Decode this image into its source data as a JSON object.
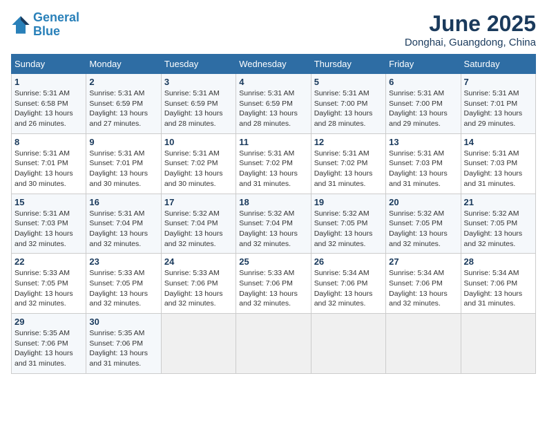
{
  "header": {
    "logo_line1": "General",
    "logo_line2": "Blue",
    "month_year": "June 2025",
    "location": "Donghai, Guangdong, China"
  },
  "weekdays": [
    "Sunday",
    "Monday",
    "Tuesday",
    "Wednesday",
    "Thursday",
    "Friday",
    "Saturday"
  ],
  "weeks": [
    [
      {
        "day": "1",
        "detail": "Sunrise: 5:31 AM\nSunset: 6:58 PM\nDaylight: 13 hours\nand 26 minutes."
      },
      {
        "day": "2",
        "detail": "Sunrise: 5:31 AM\nSunset: 6:59 PM\nDaylight: 13 hours\nand 27 minutes."
      },
      {
        "day": "3",
        "detail": "Sunrise: 5:31 AM\nSunset: 6:59 PM\nDaylight: 13 hours\nand 28 minutes."
      },
      {
        "day": "4",
        "detail": "Sunrise: 5:31 AM\nSunset: 6:59 PM\nDaylight: 13 hours\nand 28 minutes."
      },
      {
        "day": "5",
        "detail": "Sunrise: 5:31 AM\nSunset: 7:00 PM\nDaylight: 13 hours\nand 28 minutes."
      },
      {
        "day": "6",
        "detail": "Sunrise: 5:31 AM\nSunset: 7:00 PM\nDaylight: 13 hours\nand 29 minutes."
      },
      {
        "day": "7",
        "detail": "Sunrise: 5:31 AM\nSunset: 7:01 PM\nDaylight: 13 hours\nand 29 minutes."
      }
    ],
    [
      {
        "day": "8",
        "detail": "Sunrise: 5:31 AM\nSunset: 7:01 PM\nDaylight: 13 hours\nand 30 minutes."
      },
      {
        "day": "9",
        "detail": "Sunrise: 5:31 AM\nSunset: 7:01 PM\nDaylight: 13 hours\nand 30 minutes."
      },
      {
        "day": "10",
        "detail": "Sunrise: 5:31 AM\nSunset: 7:02 PM\nDaylight: 13 hours\nand 30 minutes."
      },
      {
        "day": "11",
        "detail": "Sunrise: 5:31 AM\nSunset: 7:02 PM\nDaylight: 13 hours\nand 31 minutes."
      },
      {
        "day": "12",
        "detail": "Sunrise: 5:31 AM\nSunset: 7:02 PM\nDaylight: 13 hours\nand 31 minutes."
      },
      {
        "day": "13",
        "detail": "Sunrise: 5:31 AM\nSunset: 7:03 PM\nDaylight: 13 hours\nand 31 minutes."
      },
      {
        "day": "14",
        "detail": "Sunrise: 5:31 AM\nSunset: 7:03 PM\nDaylight: 13 hours\nand 31 minutes."
      }
    ],
    [
      {
        "day": "15",
        "detail": "Sunrise: 5:31 AM\nSunset: 7:03 PM\nDaylight: 13 hours\nand 32 minutes."
      },
      {
        "day": "16",
        "detail": "Sunrise: 5:31 AM\nSunset: 7:04 PM\nDaylight: 13 hours\nand 32 minutes."
      },
      {
        "day": "17",
        "detail": "Sunrise: 5:32 AM\nSunset: 7:04 PM\nDaylight: 13 hours\nand 32 minutes."
      },
      {
        "day": "18",
        "detail": "Sunrise: 5:32 AM\nSunset: 7:04 PM\nDaylight: 13 hours\nand 32 minutes."
      },
      {
        "day": "19",
        "detail": "Sunrise: 5:32 AM\nSunset: 7:05 PM\nDaylight: 13 hours\nand 32 minutes."
      },
      {
        "day": "20",
        "detail": "Sunrise: 5:32 AM\nSunset: 7:05 PM\nDaylight: 13 hours\nand 32 minutes."
      },
      {
        "day": "21",
        "detail": "Sunrise: 5:32 AM\nSunset: 7:05 PM\nDaylight: 13 hours\nand 32 minutes."
      }
    ],
    [
      {
        "day": "22",
        "detail": "Sunrise: 5:33 AM\nSunset: 7:05 PM\nDaylight: 13 hours\nand 32 minutes."
      },
      {
        "day": "23",
        "detail": "Sunrise: 5:33 AM\nSunset: 7:05 PM\nDaylight: 13 hours\nand 32 minutes."
      },
      {
        "day": "24",
        "detail": "Sunrise: 5:33 AM\nSunset: 7:06 PM\nDaylight: 13 hours\nand 32 minutes."
      },
      {
        "day": "25",
        "detail": "Sunrise: 5:33 AM\nSunset: 7:06 PM\nDaylight: 13 hours\nand 32 minutes."
      },
      {
        "day": "26",
        "detail": "Sunrise: 5:34 AM\nSunset: 7:06 PM\nDaylight: 13 hours\nand 32 minutes."
      },
      {
        "day": "27",
        "detail": "Sunrise: 5:34 AM\nSunset: 7:06 PM\nDaylight: 13 hours\nand 32 minutes."
      },
      {
        "day": "28",
        "detail": "Sunrise: 5:34 AM\nSunset: 7:06 PM\nDaylight: 13 hours\nand 31 minutes."
      }
    ],
    [
      {
        "day": "29",
        "detail": "Sunrise: 5:35 AM\nSunset: 7:06 PM\nDaylight: 13 hours\nand 31 minutes."
      },
      {
        "day": "30",
        "detail": "Sunrise: 5:35 AM\nSunset: 7:06 PM\nDaylight: 13 hours\nand 31 minutes."
      },
      null,
      null,
      null,
      null,
      null
    ]
  ]
}
